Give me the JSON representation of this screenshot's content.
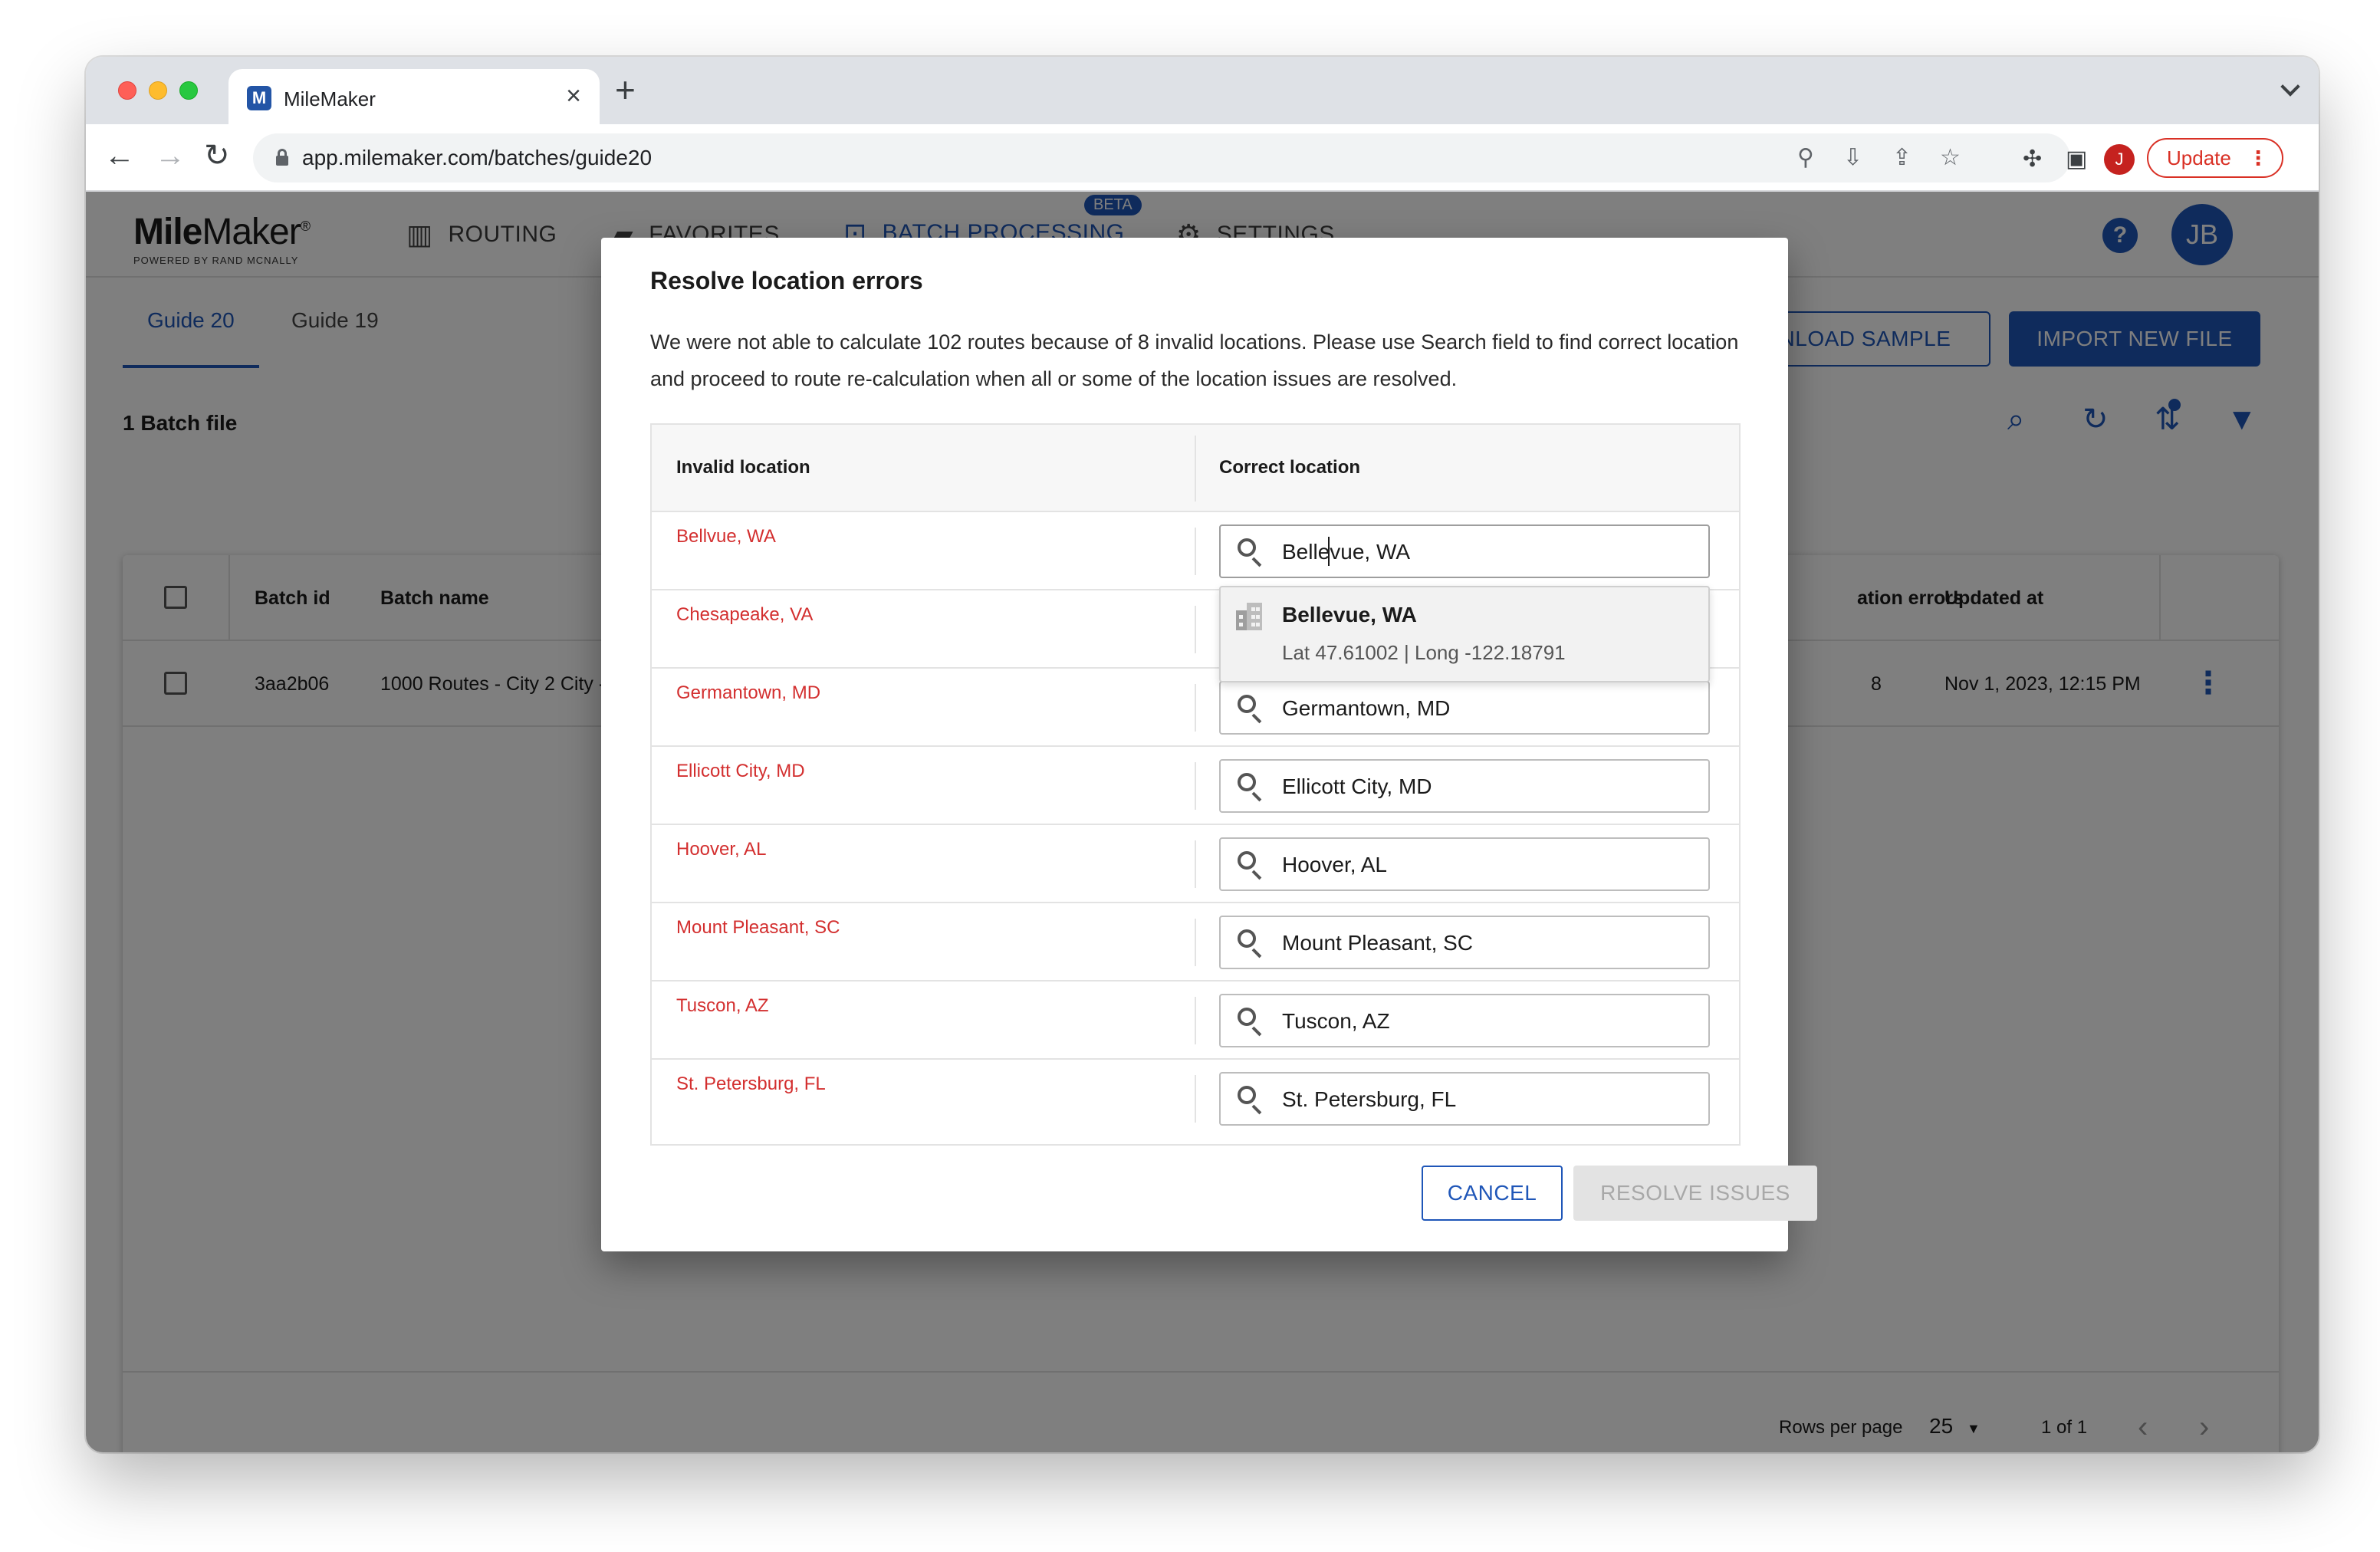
{
  "browser": {
    "tab_title": "MileMaker",
    "tab_favicon": "M",
    "tab_close": "×",
    "new_tab": "+",
    "url": "app.milemaker.com/batches/guide20",
    "update_label": "Update",
    "profile_initial": "J"
  },
  "app": {
    "logo": {
      "main_bold": "Mile",
      "main_rest": "Maker",
      "mark": "®",
      "sub": "POWERED BY RAND MCNALLY"
    },
    "nav": [
      {
        "label": "ROUTING",
        "icon": "map-icon"
      },
      {
        "label": "FAVORITES",
        "icon": "folder-star-icon"
      },
      {
        "label": "BATCH PROCESSING",
        "icon": "batch-icon",
        "active": true,
        "badge": "BETA"
      },
      {
        "label": "SETTINGS",
        "icon": "gear-icon"
      }
    ],
    "help": "?",
    "avatar": "JB",
    "guide_tabs": [
      "Guide 20",
      "Guide 19"
    ],
    "download_label": "WNLOAD SAMPLE",
    "import_label": "IMPORT NEW FILE",
    "batch_count": "1 Batch file",
    "table": {
      "headers": {
        "batch_id": "Batch id",
        "batch_name": "Batch name",
        "location_errors": "ation errors",
        "updated_at": "Updated at"
      },
      "rows": [
        {
          "batch_id": "3aa2b06",
          "batch_name": "1000 Routes - City 2 City -",
          "location_errors": "8",
          "updated_at": "Nov 1, 2023, 12:15 PM"
        }
      ]
    },
    "pager": {
      "rows_label": "Rows per page",
      "rows_value": "25",
      "range": "1 of 1"
    }
  },
  "dialog": {
    "title": "Resolve location errors",
    "description": "We were not able to calculate 102 routes because of 8 invalid locations. Please use Search field to find correct location and proceed to route re-calculation when all or some of the location issues are resolved.",
    "col_invalid": "Invalid location",
    "col_correct": "Correct location",
    "rows": [
      {
        "invalid": "Bellvue, WA",
        "correct": "Bellevue, WA"
      },
      {
        "invalid": "Chesapeake, VA",
        "correct": ""
      },
      {
        "invalid": "Germantown, MD",
        "correct": "Germantown, MD"
      },
      {
        "invalid": "Ellicott City, MD",
        "correct": "Ellicott City, MD"
      },
      {
        "invalid": "Hoover, AL",
        "correct": "Hoover, AL"
      },
      {
        "invalid": "Mount Pleasant, SC",
        "correct": "Mount Pleasant, SC"
      },
      {
        "invalid": "Tuscon, AZ",
        "correct": "Tuscon, AZ"
      },
      {
        "invalid": "St. Petersburg, FL",
        "correct": "St. Petersburg, FL"
      }
    ],
    "suggestion": {
      "title": "Bellevue, WA",
      "coords": "Lat 47.61002 | Long -122.18791"
    },
    "cancel_label": "CANCEL",
    "resolve_label": "RESOLVE ISSUES"
  },
  "colors": {
    "accent": "#1f56b8",
    "error_text": "#d32f2f",
    "disabled_bg": "#e3e3e3"
  }
}
